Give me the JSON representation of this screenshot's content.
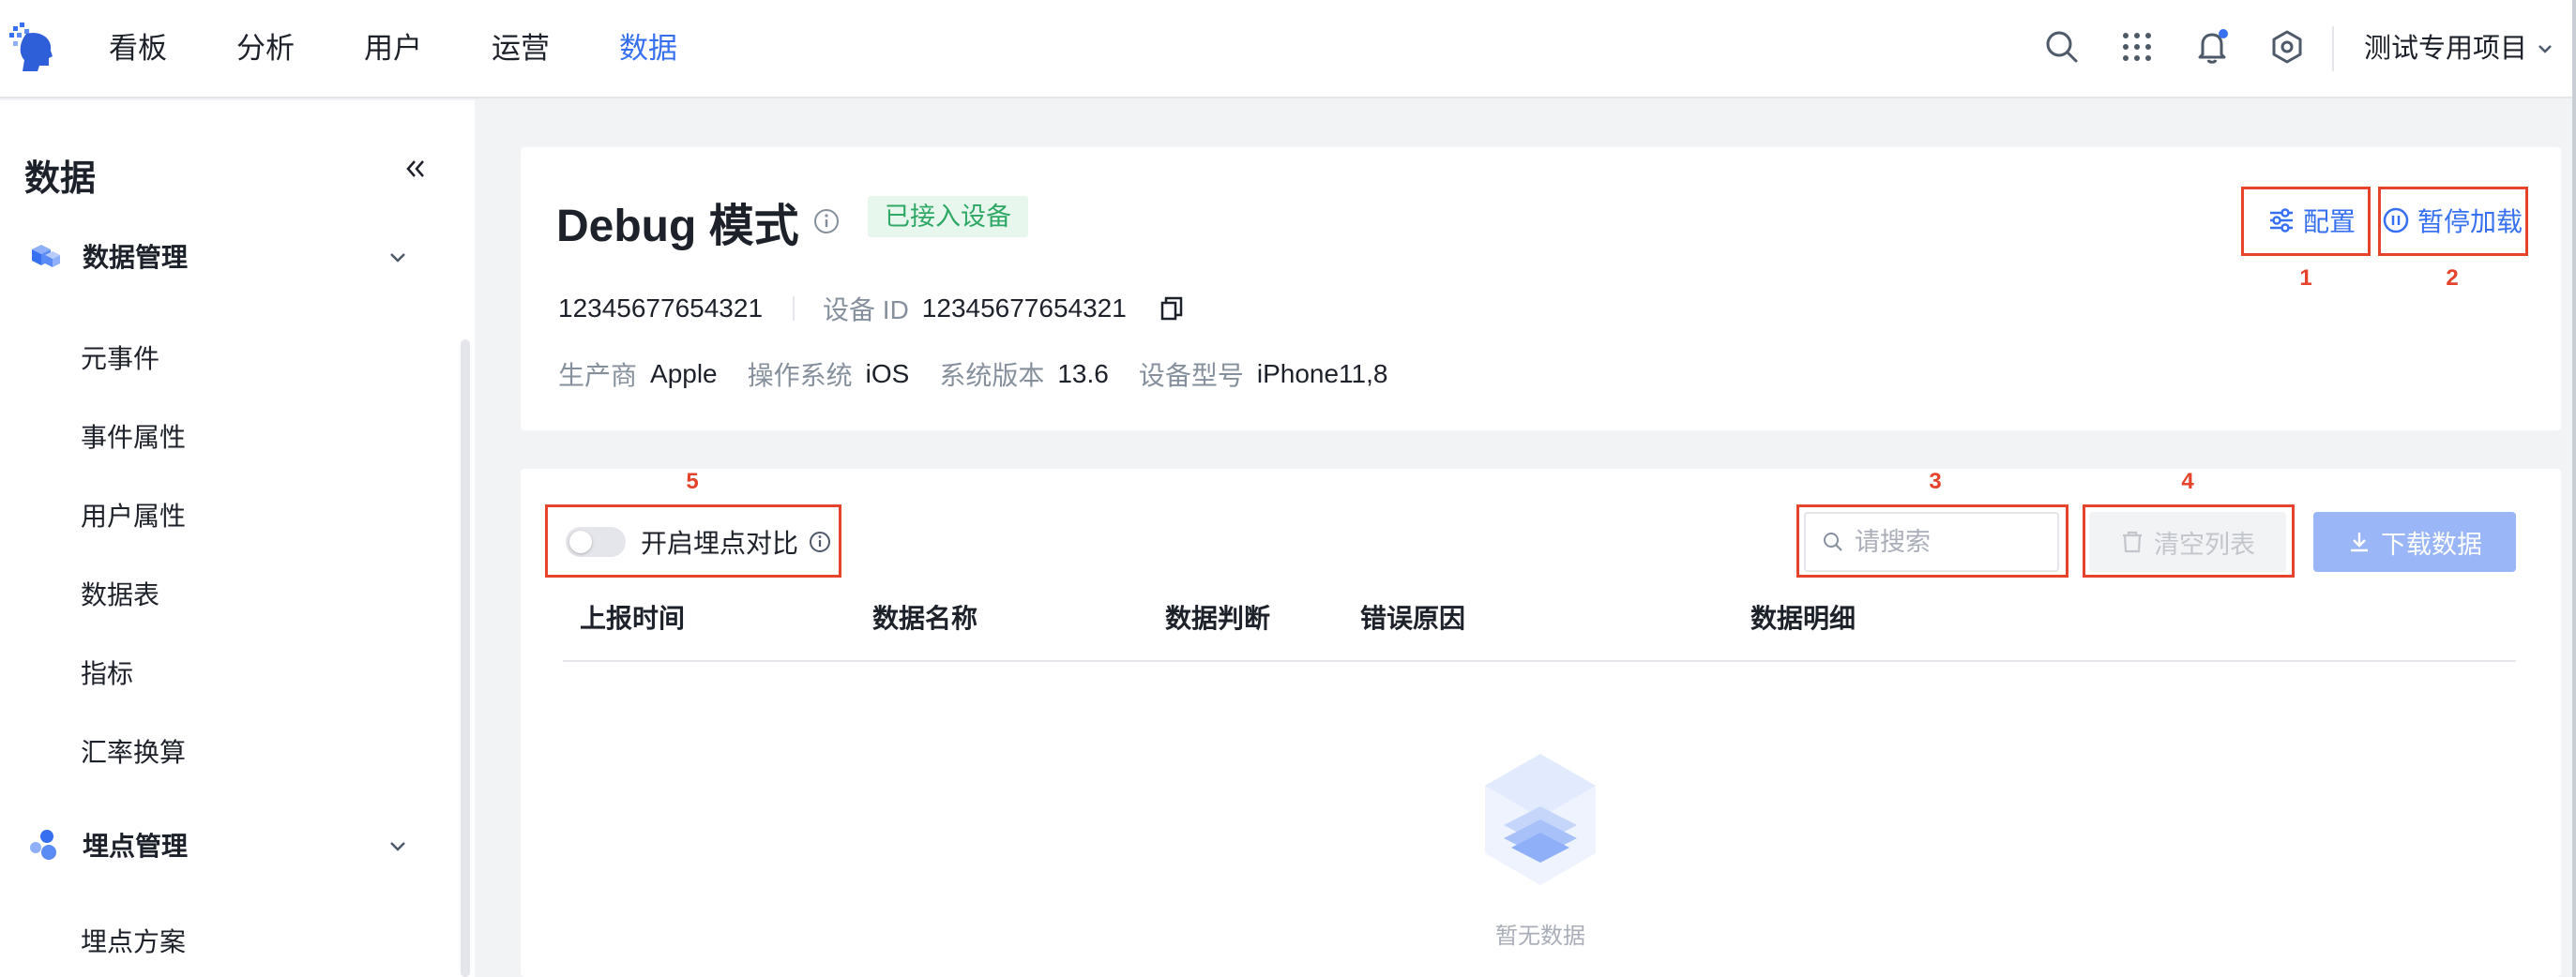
{
  "nav": {
    "items": [
      {
        "label": "看板"
      },
      {
        "label": "分析"
      },
      {
        "label": "用户"
      },
      {
        "label": "运营"
      },
      {
        "label": "数据"
      }
    ],
    "active_index": 4,
    "project": "测试专用项目",
    "icons": [
      "search-icon",
      "apps-grid-icon",
      "bell-icon",
      "settings-icon"
    ]
  },
  "sidebar": {
    "title": "数据",
    "groups": [
      {
        "label": "数据管理",
        "items": [
          "元事件",
          "事件属性",
          "用户属性",
          "数据表",
          "指标",
          "汇率换算"
        ]
      },
      {
        "label": "埋点管理",
        "items": [
          "埋点方案"
        ]
      }
    ]
  },
  "debug": {
    "title": "Debug 模式",
    "badge": "已接入设备",
    "device_code": "12345677654321",
    "device_id_label": "设备 ID",
    "device_id": "12345677654321",
    "manufacturer_label": "生产商",
    "manufacturer": "Apple",
    "os_label": "操作系统",
    "os": "iOS",
    "os_version_label": "系统版本",
    "os_version": "13.6",
    "model_label": "设备型号",
    "model": "iPhone11,8",
    "config_label": "配置",
    "pause_label": "暂停加载"
  },
  "data_panel": {
    "toggle_label": "开启埋点对比",
    "toggle_on": false,
    "search_placeholder": "请搜索",
    "clear_label": "清空列表",
    "download_label": "下载数据",
    "columns": [
      "上报时间",
      "数据名称",
      "数据判断",
      "错误原因",
      "数据明细"
    ],
    "empty_text": "暂无数据"
  },
  "annotations": [
    "1",
    "2",
    "3",
    "4",
    "5"
  ],
  "colors": {
    "accent": "#3670f0",
    "annotation": "#e5432b",
    "badge_bg": "#e8f7ee",
    "badge_text": "#2fa866"
  }
}
